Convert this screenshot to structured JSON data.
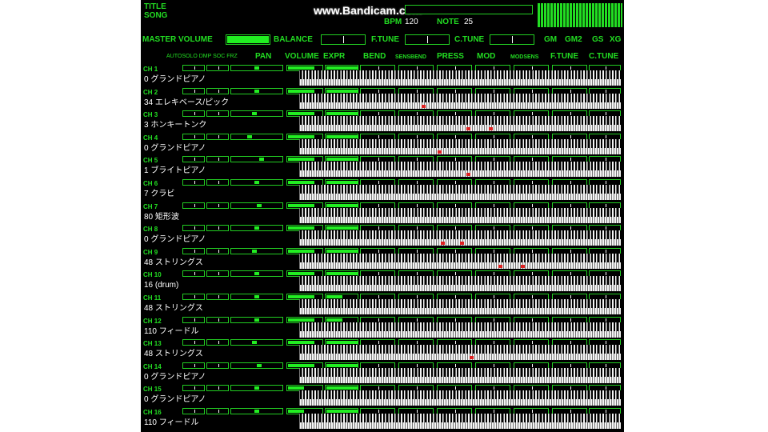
{
  "watermark": "www.Bandicam.com",
  "header": {
    "title_label": "TITLE",
    "song_label": "SONG",
    "bpm_label": "BPM",
    "bpm_value": "120",
    "note_label": "NOTE",
    "note_value": "25"
  },
  "master": {
    "master_volume_label": "MASTER VOLUME",
    "balance_label": "BALANCE",
    "ftune_label": "F.TUNE",
    "ctune_label": "C.TUNE",
    "modes": [
      "GM",
      "GM2",
      "GS",
      "XG"
    ]
  },
  "columns": {
    "sub_labels": "AUTOSOLO DMP SOC FRZ",
    "labels": [
      "PAN",
      "VOLUME",
      "EXPR",
      "BEND",
      "SENSBEND",
      "PRESS",
      "MOD",
      "MODSENS",
      "F.TUNE",
      "C.TUNE"
    ]
  },
  "colors": {
    "accent": "#22dd22",
    "note": "#e02020",
    "key_white": "#f4f4f4"
  },
  "channels": [
    {
      "ch": "CH  1",
      "instrument": "0 グランドピアノ",
      "pan": 0.5,
      "volume": 0.75,
      "expr": 1.0
    },
    {
      "ch": "CH  2",
      "instrument": "34 エレキベース/ピック",
      "pan": 0.5,
      "volume": 0.75,
      "expr": 1.0
    },
    {
      "ch": "CH  3",
      "instrument": "3 ホンキートンク",
      "pan": 0.45,
      "volume": 0.75,
      "expr": 1.0
    },
    {
      "ch": "CH  4",
      "instrument": "0 グランドピアノ",
      "pan": 0.35,
      "volume": 0.75,
      "expr": 1.0
    },
    {
      "ch": "CH  5",
      "instrument": "1 ブライトピアノ",
      "pan": 0.6,
      "volume": 0.75,
      "expr": 1.0
    },
    {
      "ch": "CH  6",
      "instrument": "7 クラビ",
      "pan": 0.5,
      "volume": 0.75,
      "expr": 1.0
    },
    {
      "ch": "CH  7",
      "instrument": "80 矩形波",
      "pan": 0.55,
      "volume": 0.75,
      "expr": 1.0
    },
    {
      "ch": "CH  8",
      "instrument": "0 グランドピアノ",
      "pan": 0.5,
      "volume": 0.75,
      "expr": 1.0
    },
    {
      "ch": "CH  9",
      "instrument": "48 ストリングス",
      "pan": 0.45,
      "volume": 0.75,
      "expr": 1.0
    },
    {
      "ch": "CH 10",
      "instrument": "16 (drum)",
      "pan": 0.5,
      "volume": 0.75,
      "expr": 1.0
    },
    {
      "ch": "CH 11",
      "instrument": "48 ストリングス",
      "pan": 0.5,
      "volume": 0.75,
      "expr": 0.5
    },
    {
      "ch": "CH 12",
      "instrument": "110 フィードル",
      "pan": 0.5,
      "volume": 0.75,
      "expr": 0.5
    },
    {
      "ch": "CH 13",
      "instrument": "48 ストリングス",
      "pan": 0.45,
      "volume": 0.75,
      "expr": 1.0
    },
    {
      "ch": "CH 14",
      "instrument": "0 グランドピアノ",
      "pan": 0.55,
      "volume": 0.75,
      "expr": 1.0
    },
    {
      "ch": "CH 15",
      "instrument": "0 グランドピアノ",
      "pan": 0.5,
      "volume": 0.45,
      "expr": 1.0
    },
    {
      "ch": "CH 16",
      "instrument": "110 フィードル",
      "pan": 0.5,
      "volume": 0.45,
      "expr": 1.0
    }
  ],
  "active_notes": [
    {
      "channel": 2,
      "key_fraction": 0.38
    },
    {
      "channel": 3,
      "key_fraction": 0.52
    },
    {
      "channel": 3,
      "key_fraction": 0.59
    },
    {
      "channel": 4,
      "key_fraction": 0.43
    },
    {
      "channel": 5,
      "key_fraction": 0.52
    },
    {
      "channel": 8,
      "key_fraction": 0.44
    },
    {
      "channel": 8,
      "key_fraction": 0.5
    },
    {
      "channel": 9,
      "key_fraction": 0.62
    },
    {
      "channel": 9,
      "key_fraction": 0.69
    },
    {
      "channel": 13,
      "key_fraction": 0.53
    }
  ]
}
